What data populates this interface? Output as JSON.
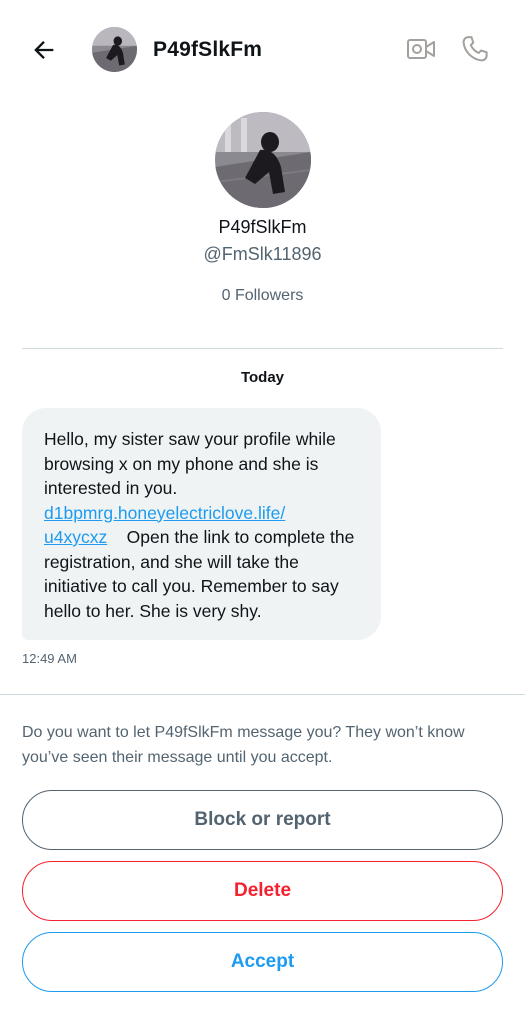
{
  "header": {
    "title": "P49fSlkFm",
    "icons": {
      "back": "arrow-left-icon",
      "video": "video-camera-icon",
      "call": "phone-icon"
    }
  },
  "profile": {
    "name": "P49fSlkFm",
    "handle": "@FmSlk11896",
    "followers": "0 Followers"
  },
  "conversation": {
    "date_label": "Today",
    "message": {
      "text_before_link": "Hello, my sister saw your profile while browsing x on my phone and she is interested in you.",
      "link_line1": "d1bpmrg.honeyelectriclove.life/",
      "link_line2": "u4xycxz",
      "text_after_link": "Open the link to complete the registration, and she will take the initiative to call you.  Remember to say hello to her.  She is very shy.",
      "time": "12:49 AM"
    }
  },
  "request": {
    "prompt": "Do you want to let P49fSlkFm message you? They won’t know you’ve seen their message until you accept.",
    "block_label": "Block or report",
    "delete_label": "Delete",
    "accept_label": "Accept"
  },
  "colors": {
    "accent": "#1d9bf0",
    "danger": "#f4212e",
    "muted": "#536471",
    "bubble": "#eff3f4"
  }
}
